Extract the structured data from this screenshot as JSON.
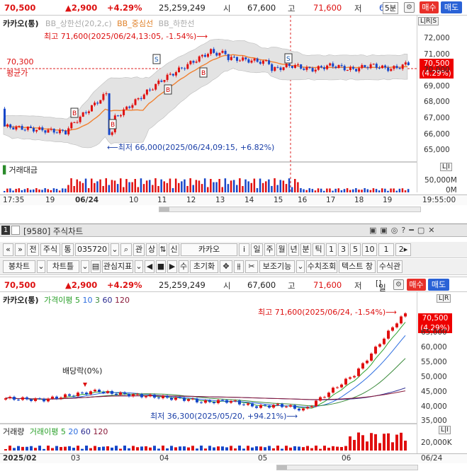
{
  "top": {
    "price": "70,500",
    "change": "▲2,900",
    "pct": "+4.29%",
    "volume": "25,259,249",
    "open_label": "시",
    "open": "67,600",
    "high_label": "고",
    "high": "71,600",
    "low_label": "저",
    "low_trunc": "6",
    "period": "5분",
    "buy": "매수",
    "sell": "매도",
    "stock": "카카오(통)",
    "legend": [
      "BB_상한선(20,2,c)",
      "BB_중심선",
      "BB_하한선"
    ],
    "max_note": "최고 71,600(2025/06/24,13:05, -1.54%)⟶",
    "min_note": "⟵최저 66,000(2025/06/24,09:15, +6.82%)",
    "ref_price": "70,300",
    "ref_label": "평균가",
    "tag_price": "70,500",
    "tag_pct": "(4.29%)",
    "price_ticks": [
      "72,000",
      "71,000",
      "70,000",
      "69,000",
      "68,000",
      "67,000",
      "66,000",
      "65,000"
    ],
    "lir": "L|R|S",
    "vol_label": "거래대금",
    "vol_ticks": [
      "50,000M",
      "0M"
    ],
    "li": "L|I",
    "x_labels": [
      "17:35",
      "19",
      "06/24",
      "10",
      "11",
      "12",
      "13",
      "14",
      "15",
      "16",
      "17",
      "18",
      "19",
      "19:55:00"
    ],
    "colors": {
      "up": "#e01010",
      "down": "#1747c9",
      "mid": "#f08030",
      "band": "#e3e3e3"
    }
  },
  "window": {
    "num": "1",
    "title": "[9580] 주식차트",
    "toolbar1": [
      "«",
      "»",
      "전",
      "주식",
      "통",
      "035720",
      "⌄",
      "⌕",
      "관",
      "상",
      "⇅",
      "신",
      "카카오",
      "i",
      "일",
      "주",
      "월",
      "년",
      "분",
      "틱",
      "1",
      "3",
      "5",
      "10",
      "1",
      "2▸"
    ],
    "toolbar2": [
      "봉차트",
      "⌄",
      "차트틀",
      "⌄",
      "▤",
      "관심지표",
      "⌄",
      "◀",
      "■",
      "▶",
      "수",
      "초기화",
      "✥",
      "⫵",
      "✂",
      "보조기능",
      "⌄",
      "수치조회",
      "텍스트 창",
      "수식관"
    ]
  },
  "bottom": {
    "price": "70,500",
    "change": "▲2,900",
    "pct": "+4.29%",
    "volume": "25,259,249",
    "open_label": "시",
    "open": "67,600",
    "high_label": "고",
    "high": "71,600",
    "low_label": "저",
    "low_trunc": "",
    "period": "일",
    "buy": "매수",
    "sell": "매도",
    "stock": "카카오(통)",
    "ma_label": "가격이평",
    "ma": [
      "5",
      "10",
      "3",
      "60",
      "120"
    ],
    "max_note": "최고 71,600(2025/06/24, -1.54%)⟶",
    "min_note": "최저 36,300(2025/05/20, +94.21%)⟶",
    "div_note": "배당락(0%)",
    "tag_price": "70,500",
    "tag_pct": "(4.29%)",
    "price_ticks": [
      "65,000",
      "60,000",
      "55,000",
      "50,000",
      "45,000",
      "40,000",
      "35,000"
    ],
    "vol_label": "거래량",
    "vol_ma_label": "거래이평",
    "vol_ma": [
      "5",
      "20",
      "60",
      "120"
    ],
    "vol_ticks": [
      "20,000K"
    ],
    "lir": "L|R",
    "li": "L|I",
    "x_labels": [
      "2025/02",
      "03",
      "04",
      "05",
      "06",
      "06/24"
    ],
    "colors": {
      "ma5": "#2aa02a",
      "ma10": "#2c6de0",
      "ma20": "#3a8a3a",
      "ma60": "#2a2a90",
      "ma120": "#8a1a3a"
    }
  }
}
